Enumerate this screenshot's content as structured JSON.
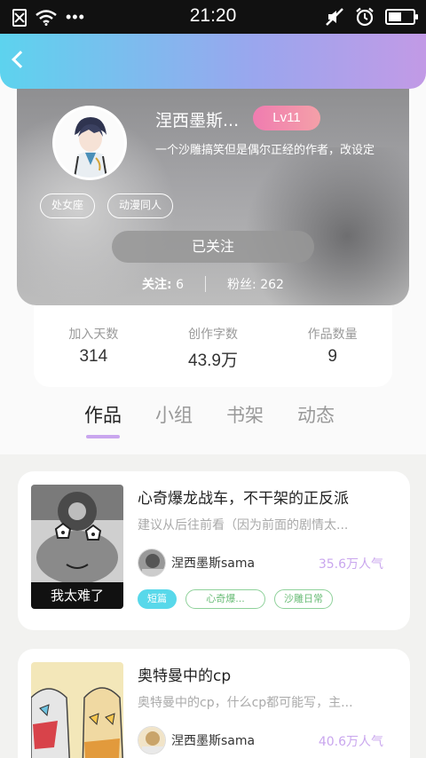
{
  "status": {
    "time": "21:20",
    "battery_level": 0.55
  },
  "profile": {
    "username": "涅西墨斯...",
    "level": "Lv11",
    "bio": "一个沙雕搞笑但是偶尔正经的作者，改设定",
    "tags": [
      "处女座",
      "动漫同人"
    ],
    "follow_button": "已关注",
    "following_label": "关注:",
    "following": "6",
    "fans_label": "粉丝:",
    "fans": "262"
  },
  "stats": [
    {
      "label": "加入天数",
      "value": "314"
    },
    {
      "label": "创作字数",
      "value": "43.9万"
    },
    {
      "label": "作品数量",
      "value": "9"
    }
  ],
  "tabs": [
    "作品",
    "小组",
    "书架",
    "动态"
  ],
  "active_tab": "作品",
  "works": [
    {
      "title": "心奇爆龙战车，不干架的正反派",
      "desc": "建议从后往前看（因为前面的剧情太...",
      "cover_caption": "我太难了",
      "author": "涅西墨斯sama",
      "popularity": "35.6万人气",
      "tags": [
        "短篇",
        "心奇爆...",
        "沙雕日常"
      ]
    },
    {
      "title": "奥特曼中的cp",
      "desc": "奥特曼中的cp，什么cp都可能写，主...",
      "author": "涅西墨斯sama",
      "popularity": "40.6万人气"
    }
  ],
  "colors": {
    "accent": "#c9a6ee",
    "topbar_start": "#5dd3ee",
    "level_badge": "#f07cb0",
    "tag_fill": "#58d8ea"
  }
}
